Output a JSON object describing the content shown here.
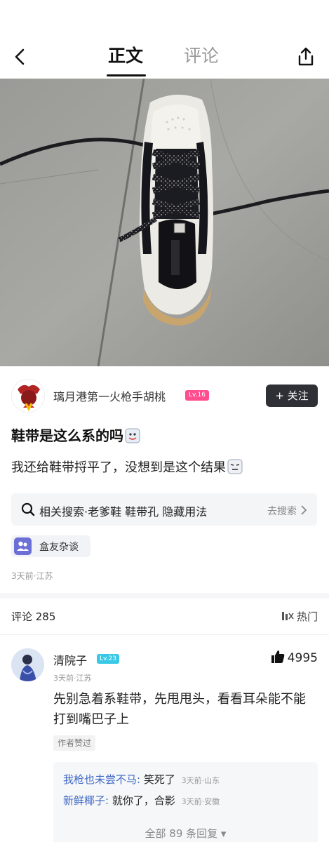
{
  "nav": {
    "tab_active": "正文",
    "tab_inactive": "评论"
  },
  "author": {
    "name": "璃月港第一火枪手胡桃",
    "level": "Lv.16",
    "follow_label": "关注",
    "follow_icon": "+"
  },
  "post": {
    "title": "鞋带是这么系的吗",
    "body": "我还给鞋带捋平了，没想到是这个结果"
  },
  "related_search": {
    "text": "相关搜索·老爹鞋 鞋带孔 隐藏用法",
    "action": "去搜索"
  },
  "topic": {
    "label": "盒友杂谈"
  },
  "meta": {
    "time_location": "3天前·江苏"
  },
  "comments_section": {
    "title": "评论 285",
    "sort_label": "热门"
  },
  "comment": {
    "user": "清院子",
    "level": "Lv.23",
    "likes": "4995",
    "meta": "3天前·江苏",
    "text": "先别急着系鞋带，先甩甩头，看看耳朵能不能打到嘴巴子上",
    "badge": "作者赞过",
    "replies": [
      {
        "user": "我枪也未尝不马:",
        "text": "笑死了",
        "meta": "3天前·山东"
      },
      {
        "user": "新鲜椰子:",
        "text": "就你了，合影",
        "meta": "3天前·安徽"
      }
    ],
    "all_replies": "全部 89 条回复 ▾"
  },
  "colors": {
    "follow_bg": "#2e3036",
    "author_level_badge": "#ff4d8f",
    "comment_level_badge": "#39c9e6",
    "reply_user": "#3f68c4",
    "topic_icon": "#6b6fd6"
  },
  "icons": [
    "back-arrow-icon",
    "share-icon",
    "search-icon",
    "chevron-right-icon",
    "group-icon",
    "sort-icon",
    "thumbs-up-icon"
  ]
}
